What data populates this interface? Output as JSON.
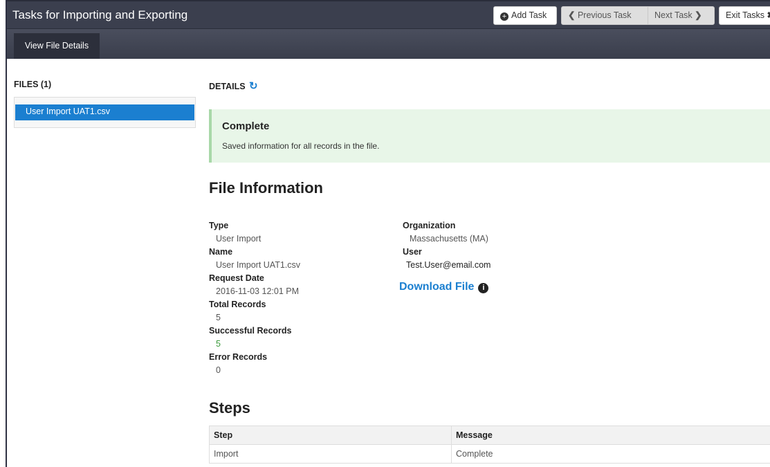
{
  "header": {
    "title": "Tasks for Importing and Exporting",
    "add_task": "Add Task",
    "previous_task": "Previous Task",
    "next_task": "Next Task",
    "exit_tasks": "Exit Tasks"
  },
  "subnav": {
    "tab": "View File Details"
  },
  "files": {
    "title": "FILES (1)",
    "items": [
      {
        "name": "User Import UAT1.csv"
      }
    ]
  },
  "details": {
    "title": "DETAILS",
    "status": {
      "title": "Complete",
      "message": "Saved information for all records in the file.",
      "color": "#e8f6e8"
    }
  },
  "file_info": {
    "heading": "File Information",
    "type_label": "Type",
    "type_value": "User Import",
    "name_label": "Name",
    "name_value": "User Import UAT1.csv",
    "request_date_label": "Request Date",
    "request_date_value": "2016-11-03 12:01 PM",
    "total_records_label": "Total Records",
    "total_records_value": "5",
    "successful_records_label": "Successful Records",
    "successful_records_value": "5",
    "error_records_label": "Error Records",
    "error_records_value": "0",
    "organization_label": "Organization",
    "organization_value": "Massachusetts (MA)",
    "user_label": "User",
    "user_value": "Test.User@email.com",
    "download_label": "Download File"
  },
  "steps": {
    "heading": "Steps",
    "columns": [
      "Step",
      "Message"
    ],
    "rows": [
      {
        "step": "Import",
        "message": "Complete"
      }
    ]
  },
  "icons": {
    "add": "plus-circle-icon",
    "previous": "chevron-left-icon",
    "next": "chevron-right-icon",
    "exit": "close-icon",
    "refresh": "refresh-icon",
    "info": "info-icon"
  },
  "colors": {
    "topbar": "#3b3f4e",
    "accent": "#1b7fd0",
    "success_text": "#3b9a3b"
  }
}
